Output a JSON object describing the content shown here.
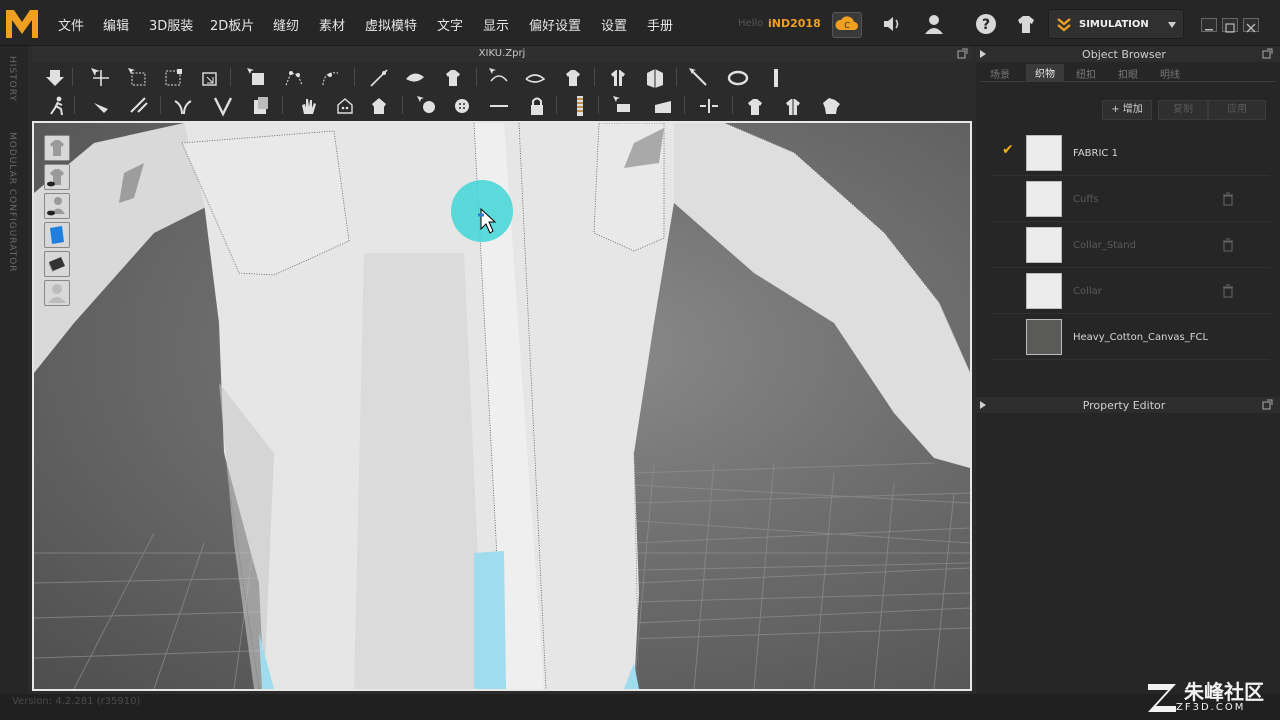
{
  "menubar": {
    "items": [
      "文件",
      "编辑",
      "3D服装",
      "2D板片",
      "缝纫",
      "素材",
      "虚拟模特",
      "文字",
      "显示",
      "偏好设置",
      "设置",
      "手册"
    ],
    "hello": "Hello",
    "username": "iND2018",
    "mode": "SIMULATION"
  },
  "left_strip": {
    "history": "HISTORY",
    "modular": "MODULAR CONFIGURATOR"
  },
  "document": {
    "title": "XIKU.Zprj"
  },
  "object_browser": {
    "title": "Object Browser",
    "tabs": [
      "场景",
      "织物",
      "纽扣",
      "扣眼",
      "明线"
    ],
    "active_tab": "织物",
    "buttons": {
      "add": "+ 增加",
      "copy": "复制",
      "apply": "应用"
    },
    "fabrics": [
      {
        "name": "FABRIC 1",
        "checked": true,
        "dim": false,
        "deletable": false,
        "color": "#ececec"
      },
      {
        "name": "Cuffs",
        "checked": false,
        "dim": true,
        "deletable": true,
        "color": "#ececec"
      },
      {
        "name": "Collar_Stand",
        "checked": false,
        "dim": true,
        "deletable": true,
        "color": "#ececec"
      },
      {
        "name": "Collar",
        "checked": false,
        "dim": true,
        "deletable": true,
        "color": "#ececec"
      },
      {
        "name": "Heavy_Cotton_Canvas_FCL",
        "checked": false,
        "dim": false,
        "deletable": false,
        "color": "#5a5a58"
      }
    ]
  },
  "property_editor": {
    "title": "Property Editor"
  },
  "status": {
    "version": "Version: 4.2.281 (r35910)"
  },
  "watermark": {
    "text": "朱峰社区",
    "url": "ZF3D.COM"
  },
  "colors": {
    "accent": "#f0a020",
    "cursor_highlight": "#3fd6d6"
  },
  "toolbar_icons": {
    "row1": [
      "move-down-icon",
      "transform-pattern-icon",
      "select-box-icon",
      "transform-box-icon",
      "fold-icon",
      "edit-pattern-icon",
      "edit-point-icon",
      "edit-curve-icon",
      "segment-sewing-icon",
      "free-sewing-icon",
      "garment-tuck-icon",
      "arrange-icon",
      "pin-icon",
      "shirt-icon",
      "avatar-icon",
      "measure-icon",
      "strap-icon",
      "ruler-icon"
    ],
    "row2": [
      "walk-icon",
      "steam-icon",
      "iron-icon",
      "edit-sewing-icon",
      "check-sewing-icon",
      "fold-arrange-icon",
      "hand-icon",
      "zoom-icon",
      "puckering-icon",
      "button-icon",
      "buttonhole-icon",
      "topstitch-icon",
      "lock-icon",
      "zipper-icon",
      "piping-icon",
      "elastic-icon",
      "split-icon",
      "shirt-front-icon",
      "shirt-back-icon",
      "shirt-side-icon"
    ]
  }
}
